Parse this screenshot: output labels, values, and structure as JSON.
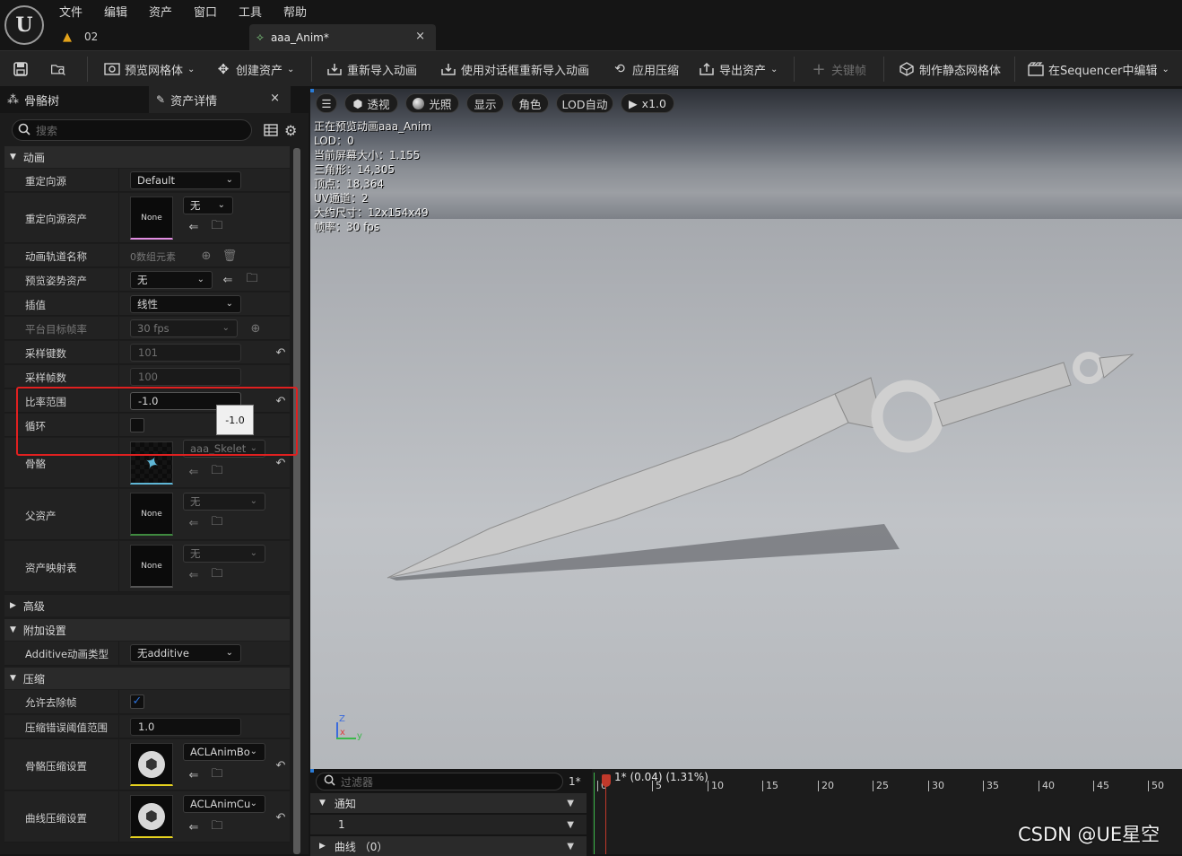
{
  "menu": {
    "items": [
      "文件",
      "编辑",
      "资产",
      "窗口",
      "工具",
      "帮助"
    ]
  },
  "doc_tabs": [
    {
      "label": "02"
    },
    {
      "label": "aaa_Anim*",
      "close": "×"
    }
  ],
  "toolbar": {
    "preview_mesh": "预览网格体",
    "create_asset": "创建资产",
    "reimport": "重新导入动画",
    "reimport_dialog": "使用对话框重新导入动画",
    "apply_compression": "应用压缩",
    "export_asset": "导出资产",
    "keyframe": "关键帧",
    "make_static_mesh": "制作静态网格体",
    "edit_in_sequencer": "在Sequencer中编辑"
  },
  "left_panel": {
    "tab_skeleton": "骨骼树",
    "tab_details": "资产详情",
    "tab_close": "×",
    "search_placeholder": "搜索",
    "sections": {
      "animation": "动画",
      "advanced": "高级",
      "additive": "附加设置",
      "compression": "压缩"
    },
    "rows": {
      "retarget_source": {
        "label": "重定向源",
        "value": "Default"
      },
      "retarget_source_asset": {
        "label": "重定向源资产",
        "thumb": "None",
        "value": "无"
      },
      "anim_track_names": {
        "label": "动画轨道名称",
        "value": "0数组元素"
      },
      "preview_pose_asset": {
        "label": "预览姿势资产",
        "value": "无"
      },
      "interpolation": {
        "label": "插值",
        "value": "线性"
      },
      "platform_target_fps": {
        "label": "平台目标帧率",
        "value": "30 fps"
      },
      "sampled_keys": {
        "label": "采样键数",
        "value": "101"
      },
      "sampled_frames": {
        "label": "采样帧数",
        "value": "100"
      },
      "rate_scale": {
        "label": "比率范围",
        "value": "-1.0",
        "tooltip": "-1.0"
      },
      "loop": {
        "label": "循环"
      },
      "skeleton": {
        "label": "骨骼",
        "value": "aaa_Skelet"
      },
      "parent_asset": {
        "label": "父资产",
        "thumb": "None",
        "value": "无"
      },
      "asset_mapping_table": {
        "label": "资产映射表",
        "thumb": "None",
        "value": "无"
      },
      "additive_anim_type": {
        "label": "Additive动画类型",
        "value": "无additive"
      },
      "allow_frame_stripping": {
        "label": "允许去除帧"
      },
      "compression_error_threshold": {
        "label": "压缩错误阈值范围",
        "value": "1.0"
      },
      "bone_compression_settings": {
        "label": "骨骼压缩设置",
        "value": "ACLAnimBo"
      },
      "curve_compression_settings": {
        "label": "曲线压缩设置",
        "value": "ACLAnimCu"
      }
    }
  },
  "viewport": {
    "buttons": [
      "透视",
      "光照",
      "显示",
      "角色",
      "LOD自动",
      "x1.0"
    ],
    "stats": [
      "正在预览动画aaa_Anim",
      "LOD：0",
      "当前屏幕大小：1.155",
      "三角形：14,305",
      "顶点：18,364",
      "UV通道：2",
      "大约尺寸：12x154x49",
      "帧率：30 fps"
    ],
    "axis_z": "Z",
    "axis_x": "x",
    "axis_y": "y"
  },
  "timeline": {
    "filter_placeholder": "过滤器",
    "frame_badge": "1*",
    "tracks": {
      "notifies": "通知",
      "notify_track": "1",
      "curves": "曲线 （0）"
    },
    "playhead_readout": "1* (0.04) (1.31%)",
    "ticks": [
      "0",
      "5",
      "10",
      "15",
      "20",
      "25",
      "30",
      "35",
      "40",
      "45",
      "50"
    ]
  },
  "watermark": "CSDN @UE星空",
  "colors": {
    "highlight_box": "#e02020",
    "checkbox_checked": "#2a6fd6",
    "mesh_thumb_accent": "#5fb6d6"
  }
}
